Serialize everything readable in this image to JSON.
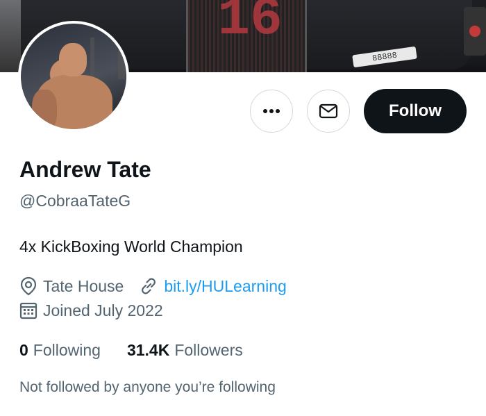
{
  "banner": {
    "car_number": "16",
    "plate_text": "88888"
  },
  "actions": {
    "more_icon": "more-horizontal-icon",
    "message_icon": "envelope-icon",
    "follow_label": "Follow"
  },
  "profile": {
    "name": "Andrew Tate",
    "handle": "@CobraaTateG",
    "bio": "4x KickBoxing World Champion",
    "location": "Tate House",
    "link": "bit.ly/HULearning",
    "joined": "Joined July 2022"
  },
  "stats": {
    "following_count": "0",
    "following_label": "Following",
    "followers_count": "31.4K",
    "followers_label": "Followers"
  },
  "mutuals_text": "Not followed by anyone you’re following",
  "colors": {
    "link": "#1d9bf0",
    "secondary_text": "#536471",
    "primary_text": "#0f1419",
    "follow_button_bg": "#0f1419"
  }
}
